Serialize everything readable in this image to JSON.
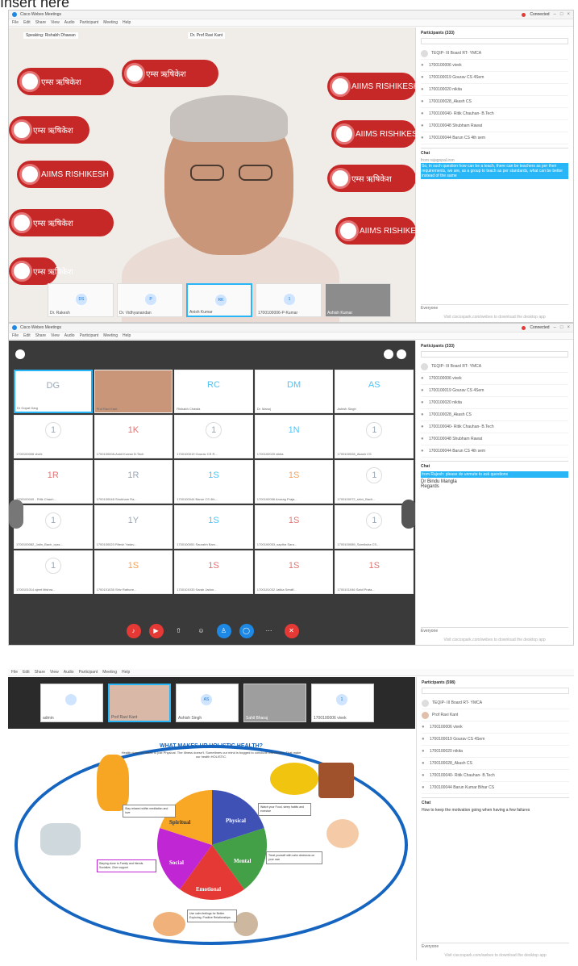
{
  "caption": "Insert here",
  "window1": {
    "app_title": "Cisco Webex Meetings",
    "menu": [
      "File",
      "Edit",
      "Share",
      "View",
      "Audio",
      "Participant",
      "Meeting",
      "Help"
    ],
    "status": "Connected",
    "speaking_label": "Speaking: Rishabh Dhawan",
    "video_label": "Dr. Prof Ravi Kant",
    "banner_text": "एम्स ऋषिकेश",
    "banner_sub": "AIIMS RISHIKESH",
    "thumbs": [
      {
        "initials": "DS",
        "name": "Dr. Rakesh"
      },
      {
        "initials": "P",
        "name": "Dr. Vidhyanandan"
      },
      {
        "initials": "RK",
        "name": "Anish Kumar"
      },
      {
        "initials": "1",
        "name": "1700100006-P-Kumar"
      },
      {
        "initials": "",
        "name": "Ashish Kumar"
      }
    ],
    "participants_header": "Participants (333)",
    "participants": [
      "TEQIP- III Board RT- YMCA",
      "1700100006 vivek",
      "1700100019 Gourav CS 4Sem",
      "1700100020 nikita",
      "1700100028_Akash CS",
      "1700100040- Ritik Chauhan- B.Tech",
      "1700100048 Shubham Rawat",
      "1700100044 Barun CS 4th sem"
    ],
    "chat_header": "Chat",
    "chat_from": "from rajagopal.iron",
    "chat_msg": "So, in such question how can be a teach, there can be teachers as per their requirements, we are, as a group to teach as per standards, what can be better instead of the same",
    "chat_to": "Everyone",
    "chat_note": "Visit ciscospark.com/webex to download the desktop app"
  },
  "window2": {
    "app_title": "Cisco Webex Meetings",
    "menu": [
      "File",
      "Edit",
      "Share",
      "View",
      "Audio",
      "Participant",
      "Meeting",
      "Help"
    ],
    "status": "Connected",
    "participants_header": "Participants (333)",
    "participants": [
      "TEQIP- III Board RT- YMCA",
      "1700100006 vivek",
      "1700100019 Gourav CS 4Sem",
      "1700100020 nikita",
      "1700100028_Akash CS",
      "1700100040- Ritik Chauhan- B.Tech",
      "1700100048 Shubham Rawat",
      "1700100044 Barun CS 4th sem"
    ],
    "tiles": [
      {
        "ini": "DG",
        "name": "Dr Gopal Garg",
        "cls": ""
      },
      {
        "ini": "",
        "name": "Prof Ravi Kant",
        "cls": "photo"
      },
      {
        "ini": "RC",
        "name": "Rishabh Chawla",
        "cls": "t"
      },
      {
        "ini": "DM",
        "name": "Dr. Manoj",
        "cls": "t"
      },
      {
        "ini": "AS",
        "name": "Ashish Singh",
        "cls": "t"
      },
      {
        "ini": "1",
        "name": "1700100006 vivek",
        "cls": "c"
      },
      {
        "ini": "1K",
        "name": "1700100008-Ankit Kumar B.Tech",
        "cls": "r"
      },
      {
        "ini": "1",
        "name": "1700100019 Gourav CS R...",
        "cls": "c"
      },
      {
        "ini": "1N",
        "name": "1700100020 nikita",
        "cls": "t"
      },
      {
        "ini": "1",
        "name": "1700100028_Akash CS",
        "cls": "c"
      },
      {
        "ini": "1R",
        "name": "1700100040 - Ritik Chauh...",
        "cls": "r"
      },
      {
        "ini": "1R",
        "name": "1700100048 Shubham Ra...",
        "cls": ""
      },
      {
        "ini": "1S",
        "name": "1700100044 Barun CS 4th...",
        "cls": "t"
      },
      {
        "ini": "1S",
        "name": "1700100056 Anurag Praja...",
        "cls": "o"
      },
      {
        "ini": "1",
        "name": "1700100072_shivi_Bach...",
        "cls": "c"
      },
      {
        "ini": "1",
        "name": "1700100082_Jatin_Bach_cyss...",
        "cls": "c"
      },
      {
        "ini": "1Y",
        "name": "1700100023 Ritesh Yadav...",
        "cls": ""
      },
      {
        "ini": "1S",
        "name": "1700100051 Saurabh Bam...",
        "cls": "t"
      },
      {
        "ini": "1S",
        "name": "1700100053_saptha Sara...",
        "cls": "r"
      },
      {
        "ini": "1",
        "name": "1700100089_Samiksha CS...",
        "cls": "c"
      },
      {
        "ini": "1",
        "name": "1700101014 ajeet Mishra...",
        "cls": "c"
      },
      {
        "ini": "1S",
        "name": "1700101035 Shiv Rathore...",
        "cls": "o"
      },
      {
        "ini": "1S",
        "name": "1700101033 Sarah Jadon...",
        "cls": "r"
      },
      {
        "ini": "1S",
        "name": "1700101032 Jatika Seraff...",
        "cls": "r"
      },
      {
        "ini": "1S",
        "name": "1700101046 Sahil Prata...",
        "cls": "r"
      }
    ],
    "chat_header": "Chat",
    "chat_hl": "from Rajesh: please do unmute to ask questions",
    "chat_name": "Dr Bindu Mangla",
    "chat_msg": "Regards",
    "chat_to": "Everyone",
    "chat_note": "Visit ciscospark.com/webex to download the desktop app"
  },
  "window3": {
    "menu": [
      "File",
      "Edit",
      "Share",
      "View",
      "Audio",
      "Participant",
      "Meeting",
      "Help"
    ],
    "participants_header": "Participants (598)",
    "participants": [
      "TEQIP- III Board RT- YMCA",
      "Prof Ravi Kant",
      "1700100006 vivek",
      "1700100019 Gourav CS 4Sem",
      "1700100020 nikita",
      "1700100028_Akash CS",
      "1700100040- Ritik Chauhan- B.Tech",
      "1700100044 Barun Kumar Bihar CS"
    ],
    "strip": [
      {
        "ini": "",
        "name": "admin"
      },
      {
        "ini": "",
        "name": "Prof Ravi Kant"
      },
      {
        "ini": "AS",
        "name": "Ashish Singh"
      },
      {
        "ini": "",
        "name": "Sahil Bharaj"
      },
      {
        "ini": "1",
        "name": "1700100006 vivek"
      }
    ],
    "slide_title": "WHAT MAKES UP HOLISTIC HEALTH?",
    "slide_sub": "Health does not mean to just Physical. The Illness doesn't. Sometimes our mind is bogged to conclude this factors. That make our health HOLISTIC.",
    "segments": [
      "Spiritual",
      "Physical",
      "Mental",
      "Emotional",
      "Social"
    ],
    "notes": [
      "Stay relaxed within meditation and love",
      "Watch your Food, sleep habits and exercise",
      "Treat yourself with calm decisions on your own",
      "Use calm feelings for Better. Exploring. Positive Relationships",
      "Staying close to Family and friends. Socialize, Give support"
    ],
    "chat_header": "Chat",
    "chat_msg": "How to keep the motivation going when having a few failures",
    "chat_to": "Everyone",
    "chat_note": "Visit ciscospark.com/webex to download the desktop app"
  },
  "colors": {
    "accent": "#29b6f6",
    "banner_red": "#c62828",
    "spiritual": "#f9a825",
    "physical": "#3f51b5",
    "mental": "#43a047",
    "emotional": "#e53935",
    "social": "#c026d3"
  }
}
